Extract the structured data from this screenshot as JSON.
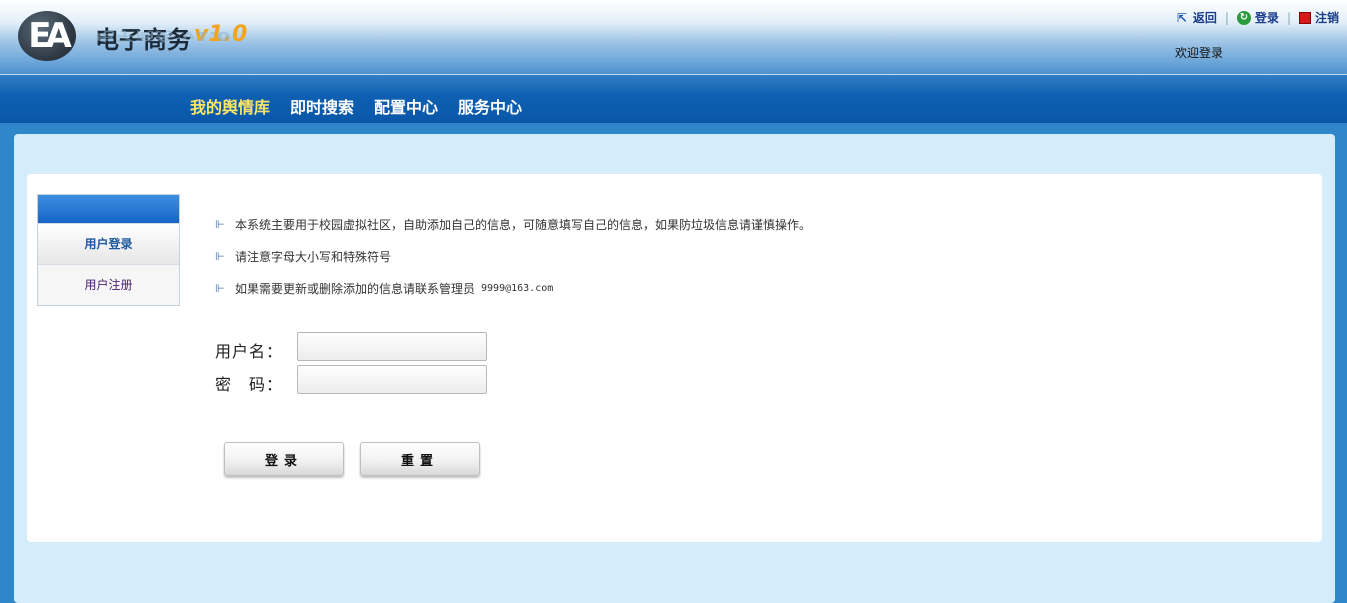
{
  "header": {
    "logo_mark": "EA",
    "title": "电子商务",
    "version": "v1.0",
    "welcome": "欢迎登录",
    "links": {
      "back": "返回",
      "login": "登录",
      "logout": "注销"
    },
    "icons": {
      "back": "back-arrow-icon",
      "login": "refresh-circle-icon",
      "logout": "red-square-icon"
    }
  },
  "nav": {
    "items": [
      "我的舆情库",
      "即时搜索",
      "配置中心",
      "服务中心"
    ],
    "active_index": 0,
    "active_color": "#ffe566"
  },
  "sidebar": {
    "items": [
      "用户登录",
      "用户注册"
    ],
    "active_index": 0
  },
  "notes": [
    "本系统主要用于校园虚拟社区，自助添加自己的信息，可随意填写自己的信息，如果防垃圾信息请谨慎操作。",
    "请注意字母大小写和特殊符号",
    "如果需要更新或删除添加的信息请联系管理员"
  ],
  "admin_email": "9999@163.com",
  "form": {
    "username_label": "用户名：",
    "password_label": "密　码：",
    "username_value": "",
    "password_value": "",
    "login_button": "登录",
    "reset_button": "重置"
  },
  "colors": {
    "nav_bg": "#0e5fb2",
    "panel_bg": "#d5edfa",
    "page_bg": "#2f86c8",
    "version": "#f2a41c"
  }
}
